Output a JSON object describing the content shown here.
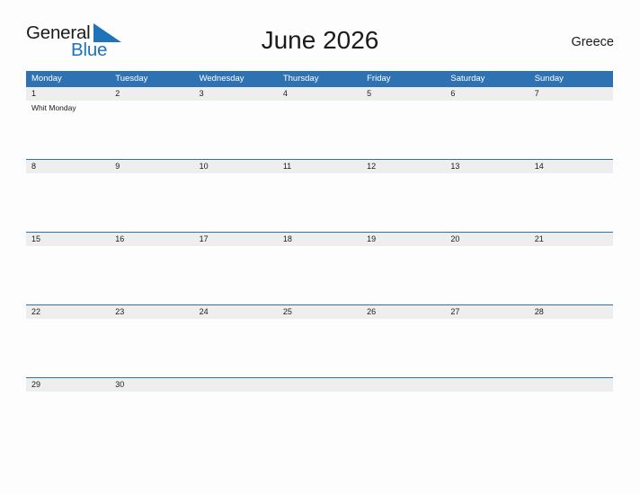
{
  "logo": {
    "word_one": "General",
    "word_two": "Blue",
    "flag_icon": "blue-triangle-flag-icon",
    "blue": "#1f73b8"
  },
  "header": {
    "title": "June 2026",
    "country": "Greece"
  },
  "theme": {
    "header_blue": "#2e72b3",
    "date_band_gray": "#eeeeee",
    "page_background": "#fdfdfd",
    "text": "#1b1b1b"
  },
  "calendar": {
    "day_headers": [
      "Monday",
      "Tuesday",
      "Wednesday",
      "Thursday",
      "Friday",
      "Saturday",
      "Sunday"
    ],
    "weeks": [
      {
        "days": [
          {
            "num": "1",
            "events": [
              "Whit Monday"
            ]
          },
          {
            "num": "2",
            "events": []
          },
          {
            "num": "3",
            "events": []
          },
          {
            "num": "4",
            "events": []
          },
          {
            "num": "5",
            "events": []
          },
          {
            "num": "6",
            "events": []
          },
          {
            "num": "7",
            "events": []
          }
        ]
      },
      {
        "days": [
          {
            "num": "8",
            "events": []
          },
          {
            "num": "9",
            "events": []
          },
          {
            "num": "10",
            "events": []
          },
          {
            "num": "11",
            "events": []
          },
          {
            "num": "12",
            "events": []
          },
          {
            "num": "13",
            "events": []
          },
          {
            "num": "14",
            "events": []
          }
        ]
      },
      {
        "days": [
          {
            "num": "15",
            "events": []
          },
          {
            "num": "16",
            "events": []
          },
          {
            "num": "17",
            "events": []
          },
          {
            "num": "18",
            "events": []
          },
          {
            "num": "19",
            "events": []
          },
          {
            "num": "20",
            "events": []
          },
          {
            "num": "21",
            "events": []
          }
        ]
      },
      {
        "days": [
          {
            "num": "22",
            "events": []
          },
          {
            "num": "23",
            "events": []
          },
          {
            "num": "24",
            "events": []
          },
          {
            "num": "25",
            "events": []
          },
          {
            "num": "26",
            "events": []
          },
          {
            "num": "27",
            "events": []
          },
          {
            "num": "28",
            "events": []
          }
        ]
      },
      {
        "days": [
          {
            "num": "29",
            "events": []
          },
          {
            "num": "30",
            "events": []
          },
          {
            "num": "",
            "events": []
          },
          {
            "num": "",
            "events": []
          },
          {
            "num": "",
            "events": []
          },
          {
            "num": "",
            "events": []
          },
          {
            "num": "",
            "events": []
          }
        ]
      }
    ]
  }
}
